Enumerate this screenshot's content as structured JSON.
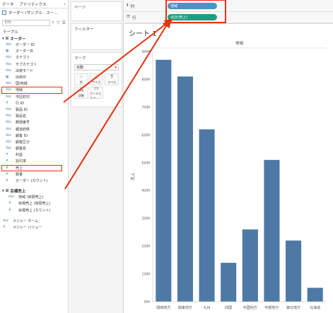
{
  "left_pane": {
    "tabs": [
      "データ",
      "アナリティクス"
    ],
    "collapse_icon": "‹",
    "datasource": "オーダー (サンプル - スー...",
    "search_placeholder": "検索",
    "section_label": "テーブル",
    "group_orders": "オーダー",
    "fields": [
      {
        "type": "Abc",
        "name": "オーダー ID"
      },
      {
        "type": "cal",
        "name": "オーダー日"
      },
      {
        "type": "Abc",
        "name": "カテゴリ"
      },
      {
        "type": "Abc",
        "name": "サブカテゴリ"
      },
      {
        "type": "Abc",
        "name": "出荷モード"
      },
      {
        "type": "cal",
        "name": "出荷日"
      },
      {
        "type": "Abc",
        "name": "国/地域"
      },
      {
        "type": "Abc",
        "name": "地域"
      },
      {
        "type": "Abc",
        "name": "市区町村"
      },
      {
        "type": "num",
        "name": "行 ID"
      },
      {
        "type": "Abc",
        "name": "製品 ID"
      },
      {
        "type": "Abc",
        "name": "製品名"
      },
      {
        "type": "Abc",
        "name": "郵便番号"
      },
      {
        "type": "Abc",
        "name": "都道府県"
      },
      {
        "type": "Abc",
        "name": "顧客 ID"
      },
      {
        "type": "Abc",
        "name": "顧客区分"
      },
      {
        "type": "Abc",
        "name": "顧客名"
      },
      {
        "type": "num",
        "name": "利益"
      },
      {
        "type": "num",
        "name": "割引率"
      },
      {
        "type": "num",
        "name": "売上"
      },
      {
        "type": "num",
        "name": "数量"
      },
      {
        "type": "num",
        "name": "オーダー (カウント)"
      }
    ],
    "group_targets": "目標売上",
    "target_fields": [
      {
        "type": "Abc",
        "name": "地域 (目標売上)"
      },
      {
        "type": "num",
        "name": "目標売上 (目標売上)"
      },
      {
        "type": "num",
        "name": "目標売上 (カウント)"
      }
    ],
    "measure_names": "メジャー ネーム",
    "measure_values": "メジャー バリュー"
  },
  "mid_pane": {
    "pages": "ページ",
    "filters": "フィルター",
    "marks": "マーク",
    "mark_type": "自動",
    "mark_buttons": [
      "色",
      "サイズ",
      "ラベル",
      "詳細",
      "ツールヒント"
    ]
  },
  "shelves": {
    "columns_label": "列",
    "rows_label": "行",
    "columns_pill": "地域",
    "rows_pill": "合計(売上)"
  },
  "sheet": {
    "title": "シート 1"
  },
  "chart_data": {
    "type": "bar",
    "title": "地域",
    "ylabel": "売上",
    "categories": [
      "関西地方",
      "関東地方",
      "九州",
      "四国",
      "中国地方",
      "中部地方",
      "東北地方",
      "北海道"
    ],
    "values": [
      87,
      81,
      62,
      14,
      26,
      51,
      22,
      5
    ],
    "y_ticks": [
      "0M",
      "10M",
      "20M",
      "30M",
      "40M",
      "50M",
      "60M",
      "70M",
      "80M",
      "90M"
    ],
    "ylim": [
      0,
      90
    ],
    "bar_color": "#4e79a7"
  },
  "colors": {
    "annotation_red": "#e8310d",
    "dimension_pill": "#4e92c5",
    "measure_pill": "#1aa37a"
  }
}
